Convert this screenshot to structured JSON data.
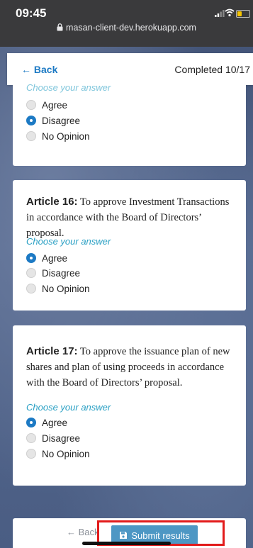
{
  "status_bar": {
    "time": "09:45",
    "url": "masan-client-dev.herokuapp.com",
    "battery_color": "#f5c400"
  },
  "header": {
    "back_label": "← Back",
    "progress": "Completed 10/17"
  },
  "prev_question": {
    "prompt": "Choose your answer",
    "options": [
      {
        "label": "Agree",
        "selected": false
      },
      {
        "label": "Disagree",
        "selected": true
      },
      {
        "label": "No Opinion",
        "selected": false
      }
    ]
  },
  "articles": [
    {
      "title": "Article 16:",
      "text": "To approve Investment Transactions in accordance with the Board of Directors’ proposal.",
      "prompt": "Choose your answer",
      "options": [
        {
          "label": "Agree",
          "selected": true
        },
        {
          "label": "Disagree",
          "selected": false
        },
        {
          "label": "No Opinion",
          "selected": false
        }
      ]
    },
    {
      "title": "Article 17:",
      "text": "To approve the issuance plan of new shares and plan of using proceeds in accordance with the Board of Directors’ proposal.",
      "prompt": "Choose your answer",
      "options": [
        {
          "label": "Agree",
          "selected": true
        },
        {
          "label": "Disagree",
          "selected": false
        },
        {
          "label": "No Opinion",
          "selected": false
        }
      ]
    }
  ],
  "footer": {
    "back_label": "← Back",
    "submit_label": "Submit results",
    "submit_icon": "save-icon"
  },
  "colors": {
    "accent": "#1d7ac4",
    "prompt": "#2aa0c4",
    "submit": "#4d97c4",
    "highlight": "#e21b1b"
  }
}
